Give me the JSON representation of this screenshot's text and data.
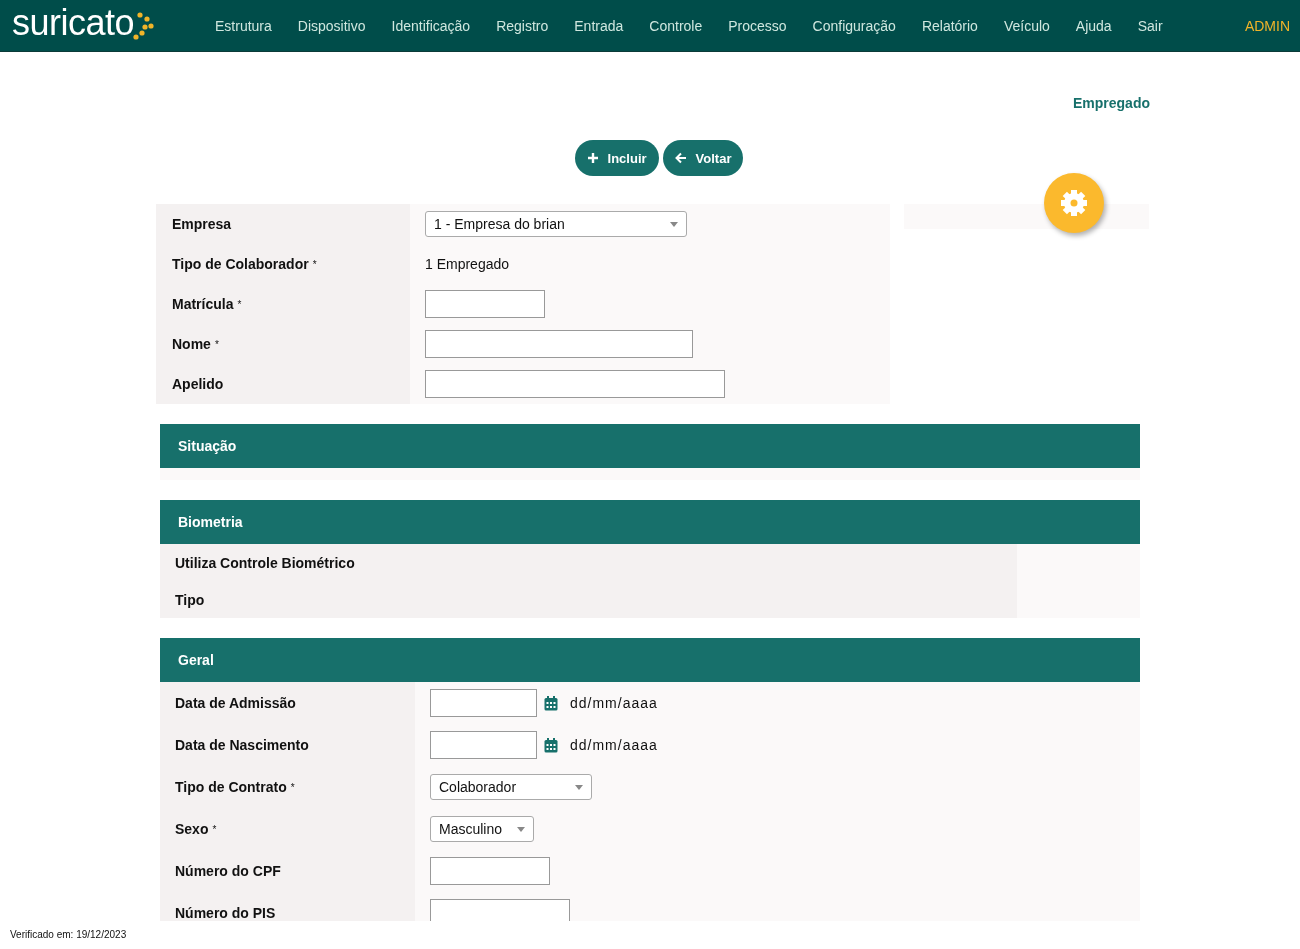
{
  "header": {
    "logo": "suricato",
    "menu": [
      "Estrutura",
      "Dispositivo",
      "Identificação",
      "Registro",
      "Entrada",
      "Controle",
      "Processo",
      "Configuração",
      "Relatório",
      "Veículo",
      "Ajuda",
      "Sair"
    ],
    "user": "ADMIN"
  },
  "page_title": "Empregado",
  "actions": [
    {
      "label": "Incluir",
      "kind": "add"
    },
    {
      "label": "Voltar",
      "kind": "back"
    }
  ],
  "top_form": [
    {
      "label": "Empresa",
      "kind": "select",
      "value": "1 - Empresa do brian"
    },
    {
      "label": "Tipo de Colaborador",
      "marker": "*",
      "kind": "text",
      "value": "1 Empregado"
    },
    {
      "label": "Matrícula",
      "marker": "*",
      "kind": "input"
    },
    {
      "label": "Nome",
      "marker": "*",
      "kind": "input"
    },
    {
      "label": "Apelido",
      "kind": "input"
    }
  ],
  "sections": [
    {
      "title": "Situação"
    },
    {
      "title": "Biometria",
      "rows": [
        {
          "label": "Utiliza Controle Biométrico",
          "kind": "none"
        },
        {
          "label": "Tipo",
          "kind": "none"
        }
      ]
    },
    {
      "title": "Geral",
      "rows": [
        {
          "label": "Data de Admissão",
          "kind": "date",
          "format": "dd/mm/aaaa"
        },
        {
          "label": "Data de Nascimento",
          "kind": "date",
          "format": "dd/mm/aaaa"
        },
        {
          "label": "Tipo de Contrato",
          "marker": "*",
          "kind": "select",
          "value": "Colaborador"
        },
        {
          "label": "Sexo",
          "marker": "*",
          "kind": "select",
          "value": "Masculino"
        },
        {
          "label": "Número do CPF",
          "kind": "input"
        },
        {
          "label": "Número do PIS",
          "kind": "input"
        }
      ]
    }
  ],
  "footer": "Verificado em: 19/12/2023"
}
